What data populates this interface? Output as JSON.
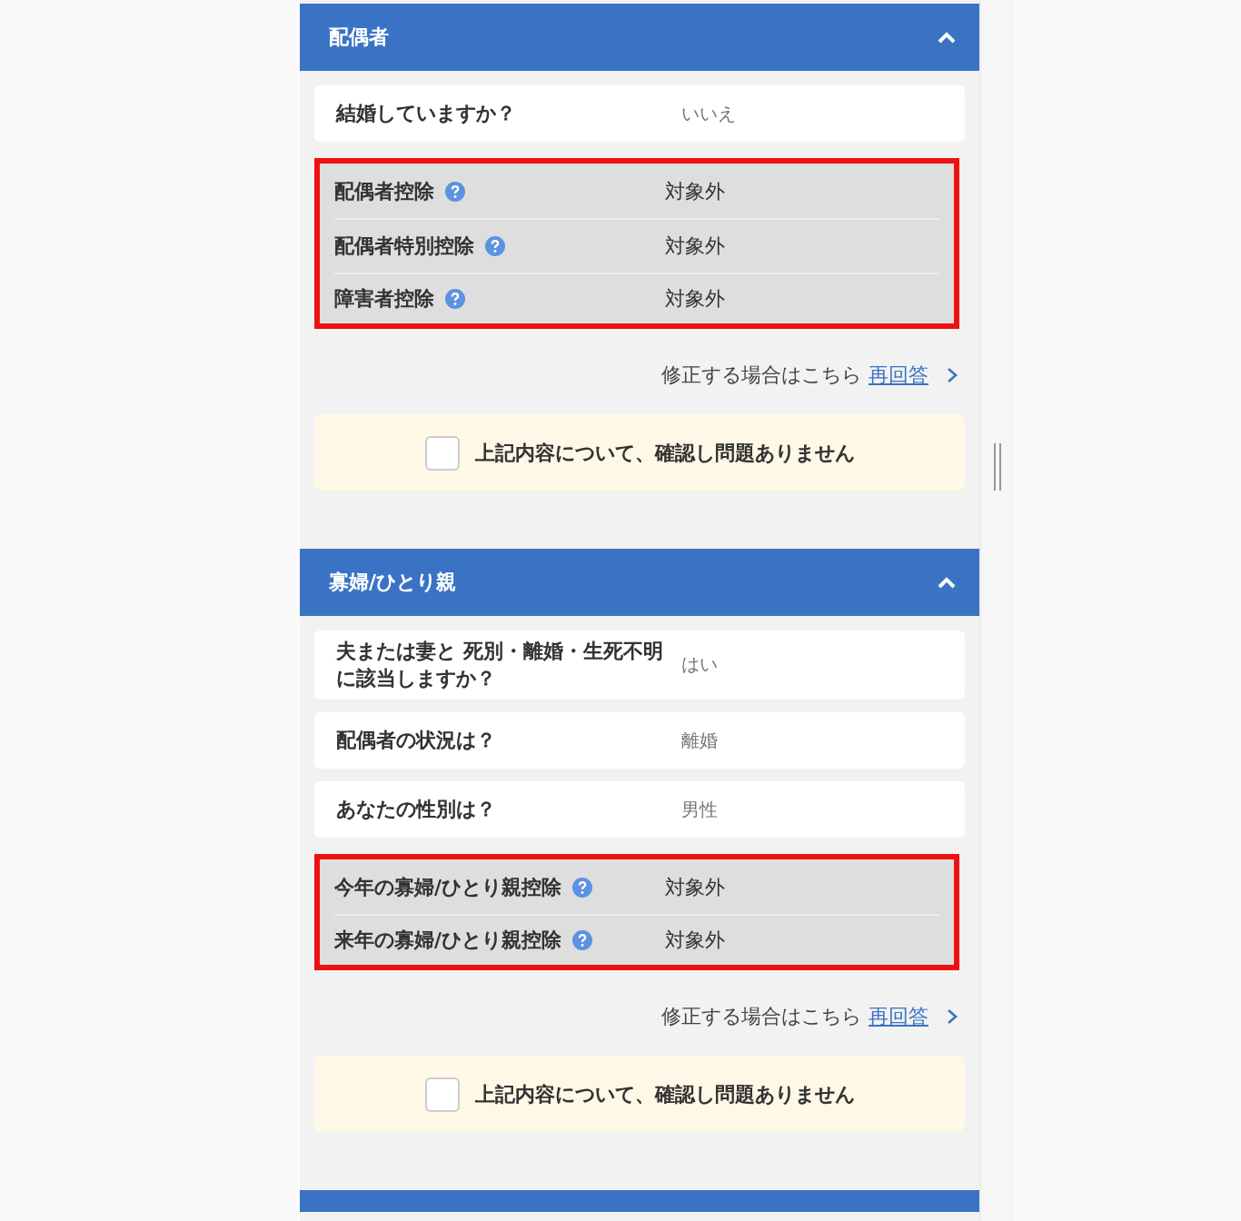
{
  "sections": [
    {
      "title": "配偶者",
      "expanded": true,
      "questions": [
        {
          "label": "結婚していますか？",
          "answer": "いいえ"
        }
      ],
      "deductions": {
        "highlighted": true,
        "items": [
          {
            "label": "配偶者控除",
            "value": "対象外",
            "help": true
          },
          {
            "label": "配偶者特別控除",
            "value": "対象外",
            "help": true
          },
          {
            "label": "障害者控除",
            "value": "対象外",
            "help": true
          }
        ]
      },
      "edit_prompt": "修正する場合はこちら",
      "edit_link": "再回答",
      "confirmation": {
        "label": "上記内容について、確認し問題ありません",
        "checked": false
      }
    },
    {
      "title": "寡婦/ひとり親",
      "expanded": true,
      "questions": [
        {
          "label": "夫または妻と 死別・離婚・生死不明に該当しますか？",
          "answer": "はい"
        },
        {
          "label": "配偶者の状況は？",
          "answer": "離婚"
        },
        {
          "label": "あなたの性別は？",
          "answer": "男性"
        }
      ],
      "deductions": {
        "highlighted": true,
        "items": [
          {
            "label": "今年の寡婦/ひとり親控除",
            "value": "対象外",
            "help": true
          },
          {
            "label": "来年の寡婦/ひとり親控除",
            "value": "対象外",
            "help": true
          }
        ]
      },
      "edit_prompt": "修正する場合はこちら",
      "edit_link": "再回答",
      "confirmation": {
        "label": "上記内容について、確認し問題ありません",
        "checked": false
      }
    }
  ]
}
